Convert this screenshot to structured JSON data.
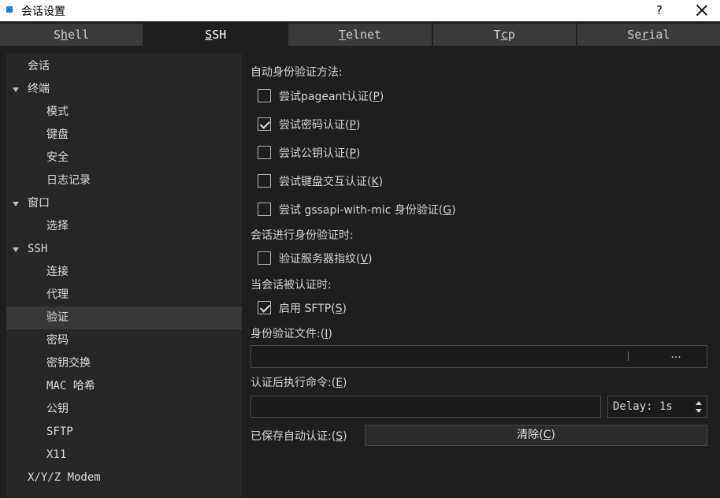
{
  "window": {
    "title": "会话设置",
    "help_label": "?"
  },
  "tabs": [
    {
      "pre": "S",
      "ul": "h",
      "post": "ell"
    },
    {
      "pre": "",
      "ul": "S",
      "post": "SH"
    },
    {
      "pre": "",
      "ul": "T",
      "post": "elnet"
    },
    {
      "pre": "T",
      "ul": "c",
      "post": "p"
    },
    {
      "pre": "Se",
      "ul": "r",
      "post": "ial"
    }
  ],
  "sidebar": {
    "items": [
      {
        "label": "会话"
      },
      {
        "label": "终端"
      },
      {
        "label": "模式"
      },
      {
        "label": "键盘"
      },
      {
        "label": "安全"
      },
      {
        "label": "日志记录"
      },
      {
        "label": "窗口"
      },
      {
        "label": "选择"
      },
      {
        "label": "SSH"
      },
      {
        "label": "连接"
      },
      {
        "label": "代理"
      },
      {
        "label": "验证"
      },
      {
        "label": "密码"
      },
      {
        "label": "密钥交换"
      },
      {
        "label": "MAC 哈希"
      },
      {
        "label": "公钥"
      },
      {
        "label": "SFTP"
      },
      {
        "label": "X11"
      },
      {
        "label": "X/Y/Z Modem"
      }
    ]
  },
  "auth": {
    "methods_label": "自动身份验证方法:",
    "opt_pageant": {
      "pre": "尝试pageant认证(",
      "key": "P",
      "post": ")"
    },
    "opt_password": {
      "pre": "尝试密码认证(",
      "key": "P",
      "post": ")"
    },
    "opt_publickey": {
      "pre": "尝试公钥认证(",
      "key": "P",
      "post": ")"
    },
    "opt_keyboard": {
      "pre": "尝试键盘交互认证(",
      "key": "K",
      "post": ")"
    },
    "opt_gssapi": {
      "pre": "尝试 gssapi-with-mic 身份验证(",
      "key": "G",
      "post": ")"
    },
    "during_label": "会话进行身份验证时:",
    "opt_verify_fp": {
      "pre": "验证服务器指纹(",
      "key": "V",
      "post": ")"
    },
    "after_label": "当会话被认证时:",
    "opt_sftp": {
      "pre": "启用 SFTP(",
      "key": "S",
      "post": ")"
    },
    "keyfile_label": {
      "pre": "身份验证文件:(",
      "key": "I",
      "post": ")"
    },
    "keyfile_value": "",
    "browse_label": "...",
    "command_label": {
      "pre": "认证后执行命令:(",
      "key": "E",
      "post": ")"
    },
    "command_value": "",
    "delay_value": "Delay: 1s",
    "saved_label": {
      "pre": "已保存自动认证:(",
      "key": "S",
      "post": ")"
    },
    "clear_label": {
      "pre": "清除(",
      "key": "C",
      "post": ")"
    }
  },
  "state": {
    "selected_sidebar": "验证",
    "active_tab": "SSH",
    "checked": {
      "pageant": false,
      "password": true,
      "publickey": false,
      "keyboard": false,
      "gssapi": false,
      "verify_fp": false,
      "sftp": true
    }
  },
  "colors": {
    "background": "#1e1e1e",
    "tab_inactive": "#3a3a3a",
    "sidebar_bg": "#262626",
    "selected_bg": "#383838",
    "app_icon": "#1f7ae0"
  }
}
